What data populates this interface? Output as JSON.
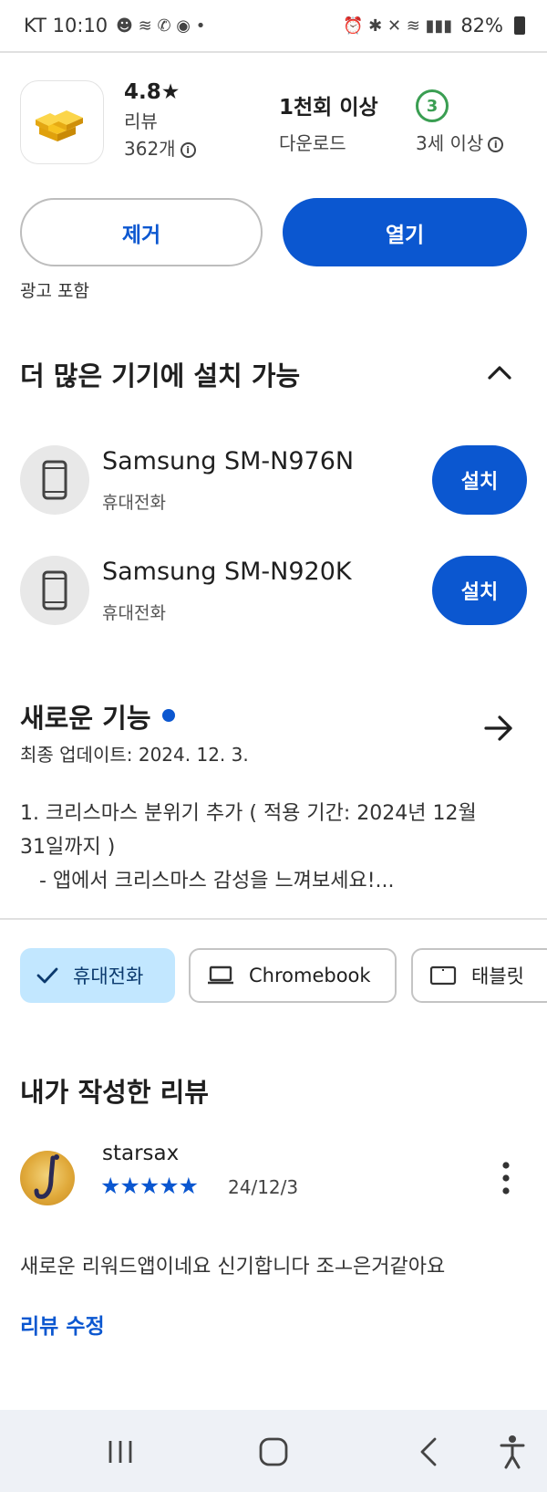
{
  "status_bar": {
    "carrier_time": "KT 10:10",
    "battery": "82%"
  },
  "app": {
    "rating": "4.8★",
    "reviews_label": "리뷰",
    "reviews_count": "362개",
    "downloads_value": "1천회 이상",
    "downloads_label": "다운로드",
    "age_rating": "3",
    "age_label": "3세 이상"
  },
  "actions": {
    "remove": "제거",
    "open": "열기",
    "ad_note": "광고 포함"
  },
  "more_devices": {
    "title": "더 많은 기기에 설치 가능",
    "devices": [
      {
        "name": "Samsung SM-N976N",
        "type": "휴대전화",
        "install": "설치"
      },
      {
        "name": "Samsung SM-N920K",
        "type": "휴대전화",
        "install": "설치"
      }
    ]
  },
  "whats_new": {
    "title": "새로운 기능",
    "updated": "최종 업데이트: 2024. 12. 3.",
    "lines": [
      "1. 크리스마스 분위기 추가 ( 적용 기간: 2024년 12월",
      "31일까지 )",
      "   - 앱에서 크리스마스 감성을 느껴보세요!..."
    ]
  },
  "device_chips": [
    {
      "label": "휴대전화",
      "icon": "check-icon",
      "selected": true
    },
    {
      "label": "Chromebook",
      "icon": "laptop-icon",
      "selected": false
    },
    {
      "label": "태블릿",
      "icon": "tablet-icon",
      "selected": false
    }
  ],
  "my_review": {
    "title": "내가 작성한 리뷰",
    "reviewer": "starsax",
    "stars": "★★★★★",
    "star_count": 5,
    "date": "24/12/3",
    "text": "새로운 리워드앱이네요 신기합니다 조ㅗ은거같아요",
    "edit_label": "리뷰 수정"
  },
  "colors": {
    "accent": "#0b57d0",
    "chip_selected_bg": "#c2e7ff",
    "age_badge": "#3a9e52"
  }
}
